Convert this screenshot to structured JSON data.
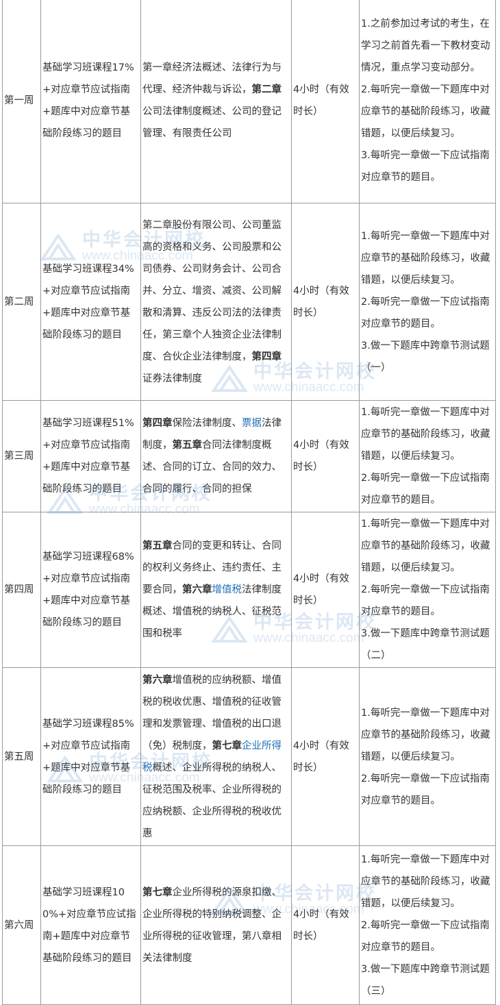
{
  "watermark": {
    "brand_cn": "中华会计网校",
    "brand_url": "www.chinaacc.com"
  },
  "rows": [
    {
      "week": "第一周",
      "course": "基础学习班课程17%+对应章节应试指南+题库中对应章节基础阶段练习的题目",
      "content": [
        {
          "text": "第一章经济法概述、法律行为与代理、经济仲裁与诉讼，",
          "style": "normal"
        },
        {
          "text": "第二章",
          "style": "bold"
        },
        {
          "text": "公司法律制度概述、公司的登记管理、有限责任公司",
          "style": "normal"
        }
      ],
      "time": "4小时（有效时长）",
      "tips": [
        "1.之前参加过考试的考生，在学习之前首先看一下教材变动情况，重点学习变动部分。",
        "2.每听完一章做一下题库中对应章节的基础阶段练习，收藏错题，以便后续复习。",
        "3.每听完一章做一下应试指南对应章节的题目。"
      ]
    },
    {
      "week": "第二周",
      "course": "基础学习班课程34%+对应章节应试指南+题库中对应章节基础阶段练习的题目",
      "content": [
        {
          "text": "第二章股份有限公司、公司董监高的资格和义务、公司股票和公司债券、公司财务会计、公司合并、分立、增资、减资、公司解散和清算、违反公司法的法律责任，第三章个人独资企业法律制度、合伙企业法律制度，",
          "style": "normal"
        },
        {
          "text": "第四章",
          "style": "bold"
        },
        {
          "text": "证券法律制度",
          "style": "normal"
        }
      ],
      "time": "4小时（有效时长）",
      "tips": [
        "1.每听完一章做一下题库中对应章节的基础阶段练习，收藏错题，以便后续复习。",
        "2.每听完一章做一下应试指南对应章节的题目。",
        "3.做一下题库中跨章节测试题（一）"
      ]
    },
    {
      "week": "第三周",
      "course": "基础学习班课程51%+对应章节应试指南+题库中对应章节基础阶段练习的题目",
      "content": [
        {
          "text": "第四章",
          "style": "bold"
        },
        {
          "text": "保险法律制度、",
          "style": "normal"
        },
        {
          "text": "票据",
          "style": "link"
        },
        {
          "text": "法律制度，",
          "style": "normal"
        },
        {
          "text": "第五章",
          "style": "bold"
        },
        {
          "text": "合同法律制度概述、合同的订立、合同的效力、合同的履行、合同的担保",
          "style": "normal"
        }
      ],
      "time": "4小时（有效时长）",
      "tips": [
        "1.每听完一章做一下题库中对应章节的基础阶段练习，收藏错题，以便后续复习。",
        "2.每听完一章做一下应试指南对应章节的题目。"
      ]
    },
    {
      "week": "第四周",
      "course": "基础学习班课程68%+对应章节应试指南+题库中对应章节基础阶段练习的题目",
      "content": [
        {
          "text": "第五章",
          "style": "bold"
        },
        {
          "text": "合同的变更和转让、合同的权利义务终止、违约责任、主要合同，",
          "style": "normal"
        },
        {
          "text": "第六章",
          "style": "bold"
        },
        {
          "text": "增值税",
          "style": "link"
        },
        {
          "text": "法律制度概述、增值税的纳税人、征税范围和税率",
          "style": "normal"
        }
      ],
      "time": "4小时（有效时长）",
      "tips": [
        "1.每听完一章做一下题库中对应章节的基础阶段练习，收藏错题，以便后续复习。",
        "2.每听完一章做一下应试指南对应章节的题目。",
        "3.做一下题库中跨章节测试题（二）"
      ]
    },
    {
      "week": "第五周",
      "course": "基础学习班课程85%+对应章节应试指南+题库中对应章节基础阶段练习的题目",
      "content": [
        {
          "text": "第六章",
          "style": "bold"
        },
        {
          "text": "增值税的应纳税额、增值税的税收优惠、增值税的征收管理和发票管理、增值税的出口退（免）税制度，",
          "style": "normal"
        },
        {
          "text": "第七章",
          "style": "bold"
        },
        {
          "text": "企业所得税",
          "style": "link"
        },
        {
          "text": "概述、企业所得税的纳税人、征税范围及税率、企业所得税的应纳税额、企业所得税的税收优惠",
          "style": "normal"
        }
      ],
      "time": "4小时（有效时长）",
      "tips": [
        "1.每听完一章做一下题库中对应章节的基础阶段练习，收藏错题，以便后续复习。",
        "2.每听完一章做一下应试指南对应章节的题目。"
      ]
    },
    {
      "week": "第六周",
      "course": "基础学习班课程100%+对应章节应试指南+题库中对应章节基础阶段练习的题目",
      "content": [
        {
          "text": "第七章",
          "style": "bold"
        },
        {
          "text": "企业所得税的源泉扣缴、企业所得税的特别纳税调整、企业所得税的征收管理，第八章相关法律制度",
          "style": "normal"
        }
      ],
      "time": "4小时（有效时长）",
      "tips": [
        "1.每听完一章做一下题库中对应章节的基础阶段练习，收藏错题，以便后续复习。",
        "2.每听完一章做一下应试指南对应章节的题目。",
        "3.做一下题库中跨章节测试题（三）"
      ]
    }
  ]
}
